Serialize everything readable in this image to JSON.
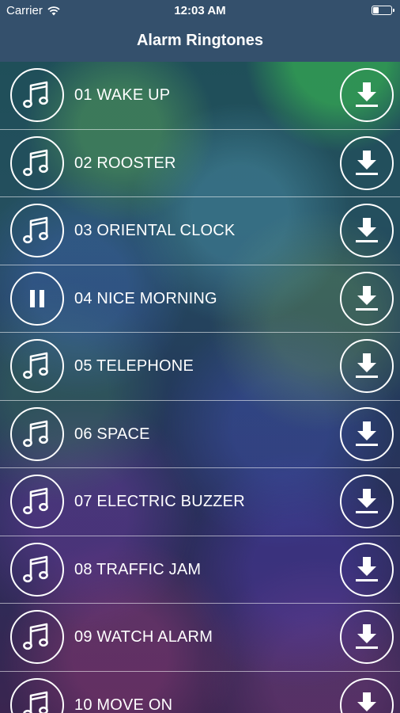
{
  "status_bar": {
    "carrier": "Carrier",
    "time": "12:03 AM",
    "battery_level": 0.35
  },
  "header": {
    "title": "Alarm Ringtones"
  },
  "tracks": [
    {
      "title": "01 WAKE UP",
      "state": "music-note-icon"
    },
    {
      "title": "02 ROOSTER",
      "state": "music-note-icon"
    },
    {
      "title": "03 ORIENTAL CLOCK",
      "state": "music-note-icon"
    },
    {
      "title": "04 NICE MORNING",
      "state": "pause-icon"
    },
    {
      "title": "05 TELEPHONE",
      "state": "music-note-icon"
    },
    {
      "title": "06 SPACE",
      "state": "music-note-icon"
    },
    {
      "title": "07 ELECTRIC BUZZER",
      "state": "music-note-icon"
    },
    {
      "title": "08 TRAFFIC JAM",
      "state": "music-note-icon"
    },
    {
      "title": "09 WATCH ALARM",
      "state": "music-note-icon"
    },
    {
      "title": "10 MOVE ON",
      "state": "music-note-icon"
    }
  ],
  "colors": {
    "header_bg": "#34506c",
    "text": "#ffffff"
  }
}
